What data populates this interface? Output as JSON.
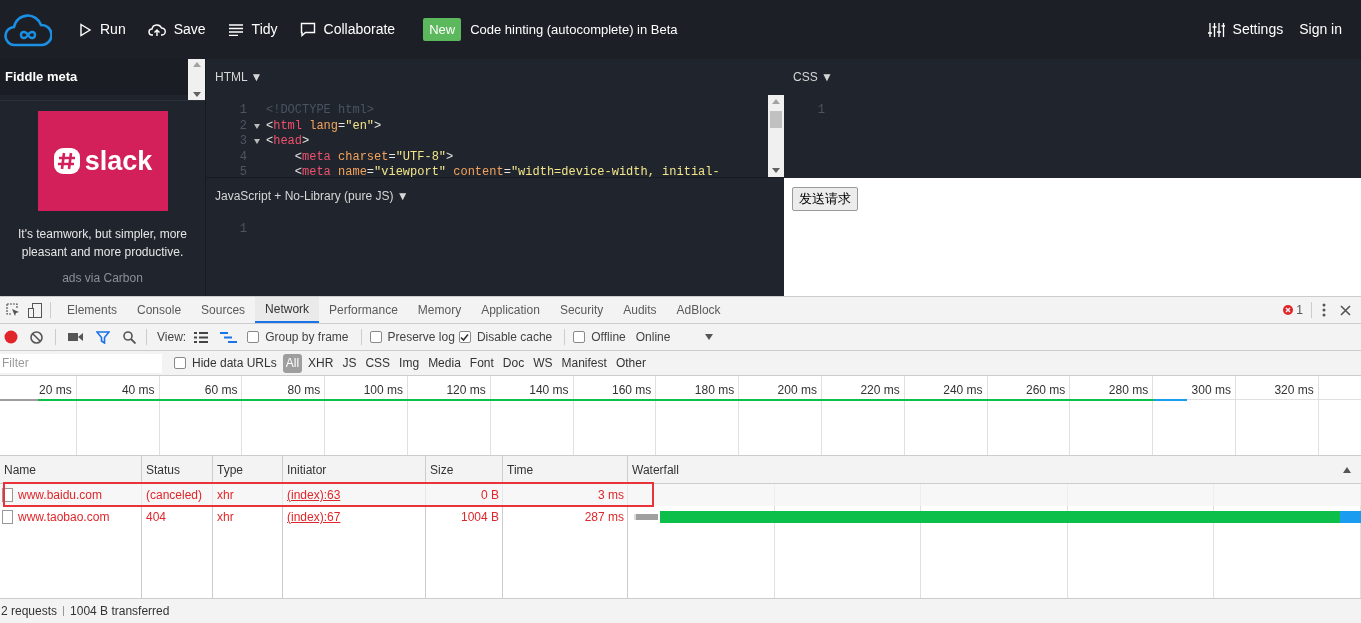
{
  "top_bar": {
    "actions": [
      {
        "label": "Run"
      },
      {
        "label": "Save"
      },
      {
        "label": "Tidy"
      },
      {
        "label": "Collaborate"
      }
    ],
    "badge": "New",
    "announcement": "Code hinting (autocomplete) in Beta",
    "right": [
      {
        "label": "Settings"
      },
      {
        "label": "Sign in"
      }
    ]
  },
  "sidebar": {
    "title": "Fiddle meta",
    "ad_logo": "slack",
    "ad_text": "It's teamwork, but simpler, more pleasant and more productive.",
    "ad_credit": "ads via Carbon"
  },
  "editors": [
    {
      "title": "HTML ▼",
      "scrollbar": true,
      "lines": [
        {
          "number": "1",
          "fold": false,
          "tokens": [
            {
              "text": "<!DOCTYPE html>",
              "kind": "comment"
            }
          ]
        },
        {
          "number": "2",
          "fold": true,
          "tokens": [
            {
              "text": "<",
              "kind": "punct"
            },
            {
              "text": "html",
              "kind": "tag"
            },
            {
              "text": " lang",
              "kind": "attr"
            },
            {
              "text": "=",
              "kind": "punct"
            },
            {
              "text": "\"en\"",
              "kind": "string"
            },
            {
              "text": ">",
              "kind": "punct"
            }
          ]
        },
        {
          "number": "3",
          "fold": true,
          "tokens": [
            {
              "text": "<",
              "kind": "punct"
            },
            {
              "text": "head",
              "kind": "tag"
            },
            {
              "text": ">",
              "kind": "punct"
            }
          ]
        },
        {
          "number": "4",
          "fold": false,
          "tokens": [
            {
              "text": "    <",
              "kind": "punct"
            },
            {
              "text": "meta",
              "kind": "tag"
            },
            {
              "text": " charset",
              "kind": "attr"
            },
            {
              "text": "=",
              "kind": "punct"
            },
            {
              "text": "\"UTF-8\"",
              "kind": "string"
            },
            {
              "text": ">",
              "kind": "punct"
            }
          ]
        },
        {
          "number": "5",
          "fold": false,
          "tokens": [
            {
              "text": "    <",
              "kind": "punct"
            },
            {
              "text": "meta",
              "kind": "tag"
            },
            {
              "text": " name",
              "kind": "attr"
            },
            {
              "text": "=",
              "kind": "punct"
            },
            {
              "text": "\"viewport\"",
              "kind": "string"
            },
            {
              "text": " content",
              "kind": "attr"
            },
            {
              "text": "=",
              "kind": "punct"
            },
            {
              "text": "\"width=device-width, initial-",
              "kind": "string"
            }
          ]
        }
      ]
    },
    {
      "title": "CSS ▼",
      "scrollbar": false,
      "lines": [
        {
          "number": "1",
          "fold": false
        }
      ]
    },
    {
      "title": "JavaScript + No-Library (pure JS) ▼",
      "scrollbar": false,
      "lines": [
        {
          "number": "1",
          "fold": false
        }
      ]
    }
  ],
  "result": {
    "button": "发送请求"
  },
  "devtools": {
    "tabs": [
      {
        "label": "Elements",
        "selected": false
      },
      {
        "label": "Console",
        "selected": false
      },
      {
        "label": "Sources",
        "selected": false
      },
      {
        "label": "Network",
        "selected": true
      },
      {
        "label": "Performance",
        "selected": false
      },
      {
        "label": "Memory",
        "selected": false
      },
      {
        "label": "Application",
        "selected": false
      },
      {
        "label": "Security",
        "selected": false
      },
      {
        "label": "Audits",
        "selected": false
      },
      {
        "label": "AdBlock",
        "selected": false
      }
    ],
    "error_count": "1",
    "toolbar": {
      "recording": true,
      "view_label": "View:",
      "options": [
        {
          "label": "Group by frame",
          "checked": false
        },
        {
          "label": "Preserve log",
          "checked": false
        },
        {
          "label": "Disable cache",
          "checked": true
        },
        {
          "label": "Offline",
          "checked": false
        }
      ],
      "throttle": "Online"
    },
    "filter": {
      "placeholder": "Filter",
      "hide_data_urls": {
        "label": "Hide data URLs",
        "checked": false
      },
      "types": [
        {
          "label": "All",
          "selected": true
        },
        {
          "label": "XHR",
          "selected": false
        },
        {
          "label": "JS",
          "selected": false
        },
        {
          "label": "CSS",
          "selected": false
        },
        {
          "label": "Img",
          "selected": false
        },
        {
          "label": "Media",
          "selected": false
        },
        {
          "label": "Font",
          "selected": false
        },
        {
          "label": "Doc",
          "selected": false
        },
        {
          "label": "WS",
          "selected": false
        },
        {
          "label": "Manifest",
          "selected": false
        },
        {
          "label": "Other",
          "selected": false
        }
      ]
    },
    "timeline": {
      "ticks": [
        "20 ms",
        "40 ms",
        "60 ms",
        "80 ms",
        "100 ms",
        "120 ms",
        "140 ms",
        "160 ms",
        "180 ms",
        "200 ms",
        "220 ms",
        "240 ms",
        "260 ms",
        "280 ms",
        "300 ms",
        "320 ms"
      ]
    },
    "table": {
      "columns": [
        "Name",
        "Status",
        "Type",
        "Initiator",
        "Size",
        "Time",
        "Waterfall"
      ],
      "rows": [
        {
          "name": "www.baidu.com",
          "status": "(canceled)",
          "type": "xhr",
          "initiator": "(index):63",
          "size": "0 B",
          "time": "3 ms",
          "highlighted": true,
          "waterfall": false
        },
        {
          "name": "www.taobao.com",
          "status": "404",
          "type": "xhr",
          "initiator": "(index):67",
          "size": "1004 B",
          "time": "287 ms",
          "highlighted": false,
          "waterfall": true
        }
      ]
    },
    "status_bar": {
      "requests": "2 requests",
      "transferred": "1004 B transferred"
    }
  }
}
